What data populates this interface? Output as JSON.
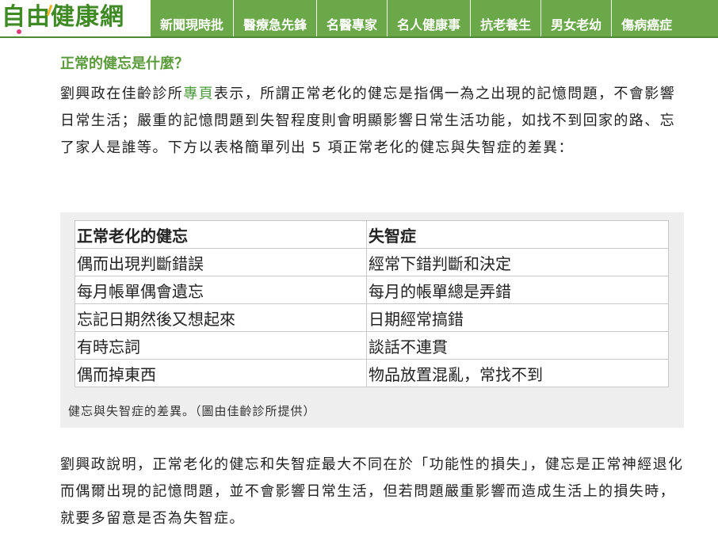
{
  "header": {
    "logo_text": "自由健康網",
    "nav": [
      "新聞現時批",
      "醫療急先鋒",
      "名醫專家",
      "名人健康事",
      "抗老養生",
      "男女老幼",
      "傷病癌症"
    ]
  },
  "article": {
    "subhead": "正常的健忘是什麼？",
    "para1": {
      "before_link": "劉興政在佳齡診所",
      "link": "專頁",
      "after_link": "表示，所謂正常老化的健忘是指偶一為之出現的記憶問題，不會影響日常生活；嚴重的記憶問題到失智程度則會明顯影響日常生活功能，如找不到回家的路、忘了家人是誰等。下方以表格簡單列出 5 項正常老化的健忘與失智症的差異："
    },
    "table": {
      "headers": [
        "正常老化的健忘",
        "失智症"
      ],
      "rows": [
        [
          "偶而出現判斷錯誤",
          "經常下錯判斷和決定"
        ],
        [
          "每月帳單偶會遺忘",
          "每月的帳單總是弄錯"
        ],
        [
          "忘記日期然後又想起來",
          "日期經常搞錯"
        ],
        [
          "有時忘詞",
          "談話不連貫"
        ],
        [
          "偶而掉東西",
          "物品放置混亂，常找不到"
        ]
      ]
    },
    "caption": "健忘與失智症的差異。（圖由佳齡診所提供）",
    "para2": "劉興政說明，正常老化的健忘和失智症最大不同在於「功能性的損失」，健忘是正常神經退化而偶爾出現的記憶問題，並不會影響日常生活，但若問題嚴重影響而造成生活上的損失時，就要多留意是否為失智症。"
  },
  "colors": {
    "brand_green": "#6aa84a",
    "logo_green": "#3f8a24",
    "subhead_green": "#5b9b3c",
    "link_green": "#4a9a3a"
  }
}
